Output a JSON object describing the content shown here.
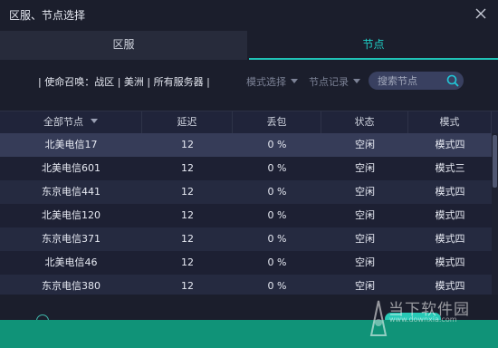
{
  "window": {
    "title": "区服、节点选择"
  },
  "tabs": [
    {
      "label": "区服",
      "active": false
    },
    {
      "label": "节点",
      "active": true
    }
  ],
  "filter": {
    "breadcrumb": "| 使命召唤：战区 | 美洲 | 所有服务器 |",
    "mode_select": "模式选择",
    "node_record": "节点记录",
    "search_placeholder": "搜索节点"
  },
  "table": {
    "headers": [
      "全部节点",
      "延迟",
      "丢包",
      "状态",
      "模式"
    ],
    "rows": [
      [
        "北美电信17",
        "12",
        "0 %",
        "空闲",
        "模式四"
      ],
      [
        "北美电信601",
        "12",
        "0 %",
        "空闲",
        "模式三"
      ],
      [
        "东京电信441",
        "12",
        "0 %",
        "空闲",
        "模式四"
      ],
      [
        "北美电信120",
        "12",
        "0 %",
        "空闲",
        "模式四"
      ],
      [
        "东京电信371",
        "12",
        "0 %",
        "空闲",
        "模式四"
      ],
      [
        "北美电信46",
        "12",
        "0 %",
        "空闲",
        "模式四"
      ],
      [
        "东京电信380",
        "12",
        "0 %",
        "空闲",
        "模式四"
      ]
    ],
    "selected_row": 0
  },
  "watermark": {
    "text": "当下软件园",
    "url": "www.downxia.com"
  },
  "colors": {
    "accent": "#20c3b6",
    "banner": "#109378",
    "background": "#1b1e2c"
  }
}
